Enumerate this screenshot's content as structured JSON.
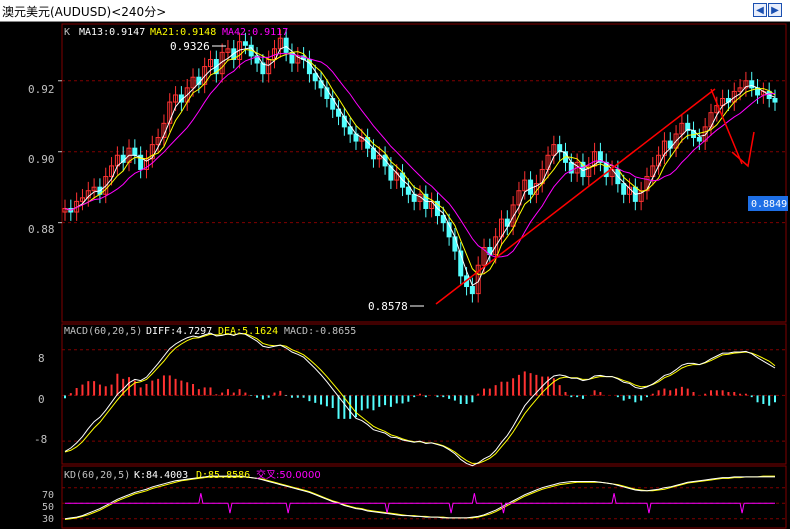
{
  "window": {
    "title": "澳元美元(AUDUSD)<240分>"
  },
  "controls": {
    "prev_icon": "arrow-left-icon",
    "next_icon": "arrow-right-icon",
    "menu_icon": "menu-icon"
  },
  "colors": {
    "up": "#ff3232",
    "down": "#54ffff",
    "ma13": "#ffffff",
    "ma21": "#ffff00",
    "ma42": "#ff00ff",
    "grid": "#800000",
    "axis_text": "#c0c0c0",
    "trend": "#ff0000",
    "price_tag_bg": "#1e6fe6"
  },
  "price_panel": {
    "label": "K",
    "ma13_label": "MA13:0.9147",
    "ma21_label": "MA21:0.9148",
    "ma42_label": "MA42:0.9117",
    "y_ticks": [
      "0.92",
      "0.90",
      "0.88"
    ],
    "high_label": "0.9326",
    "low_label": "0.8578",
    "last_price_tag": "0.8849"
  },
  "macd_panel": {
    "label": "MACD(60,20,5)",
    "diff_label": "DIFF:4.7297",
    "dea_label": "DEA:5.1624",
    "macd_label": "MACD:-0.8655",
    "y_ticks": [
      "8",
      "0",
      "-8"
    ]
  },
  "kd_panel": {
    "label": "KD(60,20,5)",
    "k_label": "K:84.4003",
    "d_label": "D:85.8586",
    "cross_label": "交叉:50.0000",
    "y_ticks": [
      "70",
      "50",
      "30"
    ]
  },
  "chart_data": {
    "type": "candlestick",
    "price_ylim": [
      0.852,
      0.936
    ],
    "macd_ylim": [
      -12,
      12.5
    ],
    "kd_ylim": [
      18,
      98
    ],
    "closes": [
      0.884,
      0.883,
      0.886,
      0.887,
      0.889,
      0.89,
      0.888,
      0.893,
      0.896,
      0.899,
      0.897,
      0.901,
      0.899,
      0.895,
      0.898,
      0.902,
      0.904,
      0.908,
      0.914,
      0.916,
      0.914,
      0.918,
      0.921,
      0.919,
      0.924,
      0.926,
      0.922,
      0.928,
      0.929,
      0.926,
      0.931,
      0.93,
      0.927,
      0.925,
      0.922,
      0.926,
      0.929,
      0.932,
      0.928,
      0.925,
      0.927,
      0.926,
      0.922,
      0.92,
      0.918,
      0.915,
      0.912,
      0.91,
      0.907,
      0.905,
      0.903,
      0.904,
      0.901,
      0.898,
      0.899,
      0.896,
      0.892,
      0.894,
      0.89,
      0.888,
      0.886,
      0.888,
      0.884,
      0.886,
      0.882,
      0.88,
      0.876,
      0.872,
      0.865,
      0.862,
      0.86,
      0.868,
      0.873,
      0.871,
      0.876,
      0.881,
      0.879,
      0.885,
      0.889,
      0.892,
      0.888,
      0.891,
      0.895,
      0.899,
      0.902,
      0.9,
      0.897,
      0.894,
      0.897,
      0.893,
      0.896,
      0.9,
      0.897,
      0.893,
      0.895,
      0.891,
      0.888,
      0.89,
      0.886,
      0.889,
      0.893,
      0.896,
      0.899,
      0.903,
      0.901,
      0.905,
      0.908,
      0.906,
      0.904,
      0.903,
      0.907,
      0.911,
      0.913,
      0.915,
      0.914,
      0.917,
      0.918,
      0.92,
      0.918,
      0.916,
      0.917,
      0.915,
      0.914
    ],
    "macd_diff": [
      -9.8,
      -9.2,
      -8.3,
      -7.2,
      -5.8,
      -4.6,
      -3.8,
      -2.6,
      -1.2,
      0.2,
      1.1,
      2.2,
      2.8,
      2.6,
      3.2,
      4.4,
      5.6,
      6.9,
      8.2,
      9.0,
      9.6,
      10.1,
      10.4,
      10.2,
      10.6,
      10.9,
      10.4,
      10.5,
      10.8,
      10.5,
      10.9,
      10.7,
      10.1,
      9.5,
      8.6,
      8.4,
      8.6,
      8.8,
      8.3,
      7.6,
      7.2,
      6.7,
      5.7,
      4.7,
      3.6,
      2.4,
      1.1,
      -0.2,
      -1.5,
      -2.8,
      -4.0,
      -4.4,
      -5.1,
      -6.0,
      -6.3,
      -6.6,
      -7.3,
      -7.4,
      -7.8,
      -8.0,
      -8.2,
      -8.0,
      -8.4,
      -8.3,
      -8.6,
      -8.9,
      -9.5,
      -10.2,
      -11.2,
      -11.9,
      -12.3,
      -11.8,
      -11.1,
      -10.6,
      -9.6,
      -8.2,
      -7.0,
      -5.4,
      -3.6,
      -1.8,
      -0.6,
      0.5,
      1.6,
      2.6,
      3.4,
      3.6,
      3.4,
      3.0,
      3.0,
      2.6,
      2.8,
      3.4,
      3.5,
      3.3,
      3.3,
      2.9,
      2.3,
      2.1,
      1.4,
      1.2,
      1.5,
      2.0,
      2.7,
      3.5,
      3.8,
      4.5,
      5.3,
      5.6,
      5.6,
      5.4,
      5.8,
      6.4,
      6.9,
      7.4,
      7.4,
      7.6,
      7.6,
      7.7,
      7.3,
      6.6,
      6.0,
      5.4,
      4.8
    ],
    "macd_dea": [
      -9.9,
      -9.6,
      -9.0,
      -8.1,
      -6.9,
      -5.7,
      -4.7,
      -3.4,
      -2.1,
      -0.8,
      0.4,
      1.4,
      2.2,
      2.4,
      2.8,
      3.8,
      4.9,
      6.0,
      7.3,
      8.3,
      9.0,
      9.6,
      10.0,
      10.1,
      10.4,
      10.7,
      10.6,
      10.6,
      10.7,
      10.6,
      10.8,
      10.8,
      10.4,
      9.9,
      9.1,
      8.8,
      8.7,
      8.8,
      8.6,
      8.0,
      7.6,
      7.1,
      6.3,
      5.4,
      4.4,
      3.3,
      2.1,
      0.9,
      -0.4,
      -1.7,
      -3.0,
      -3.8,
      -4.6,
      -5.4,
      -5.9,
      -6.3,
      -6.9,
      -7.2,
      -7.6,
      -7.9,
      -8.1,
      -8.1,
      -8.3,
      -8.3,
      -8.5,
      -8.8,
      -9.3,
      -9.9,
      -10.7,
      -11.4,
      -11.9,
      -11.9,
      -11.5,
      -11.0,
      -10.2,
      -9.0,
      -7.8,
      -6.4,
      -4.8,
      -3.2,
      -1.9,
      -0.7,
      0.5,
      1.5,
      2.4,
      3.0,
      3.2,
      3.1,
      3.1,
      2.8,
      2.8,
      3.1,
      3.3,
      3.3,
      3.3,
      3.0,
      2.6,
      2.3,
      1.8,
      1.5,
      1.6,
      1.9,
      2.4,
      3.1,
      3.5,
      4.1,
      4.8,
      5.2,
      5.4,
      5.4,
      5.7,
      6.1,
      6.6,
      7.1,
      7.2,
      7.4,
      7.5,
      7.6,
      7.4,
      7.0,
      6.5,
      6.0,
      5.2
    ],
    "kd_k": [
      30,
      31,
      32,
      34,
      37,
      40,
      43,
      47,
      51,
      55,
      58,
      61,
      64,
      66,
      68,
      71,
      73,
      75,
      77,
      79,
      80,
      81,
      82,
      83,
      84,
      85,
      85,
      85,
      85,
      85,
      85,
      84,
      83,
      82,
      80,
      78,
      76,
      74,
      72,
      70,
      68,
      66,
      64,
      61,
      58,
      55,
      52,
      50,
      47,
      45,
      43,
      42,
      40,
      39,
      38,
      37,
      36,
      35,
      34,
      34,
      33,
      33,
      32,
      32,
      32,
      31,
      31,
      31,
      31,
      31,
      32,
      33,
      35,
      38,
      41,
      45,
      49,
      53,
      57,
      61,
      64,
      67,
      70,
      72,
      74,
      76,
      77,
      78,
      78,
      78,
      78,
      78,
      77,
      76,
      75,
      73,
      71,
      69,
      67,
      66,
      66,
      67,
      68,
      70,
      71,
      73,
      75,
      77,
      78,
      79,
      80,
      81,
      82,
      83,
      83,
      84,
      84,
      84,
      84,
      84,
      84,
      84,
      84
    ],
    "kd_d": [
      29,
      30,
      31,
      33,
      35,
      38,
      41,
      45,
      49,
      53,
      56,
      59,
      62,
      64,
      66,
      69,
      71,
      73,
      75,
      77,
      79,
      80,
      81,
      82,
      83,
      84,
      84,
      84,
      84,
      84,
      84,
      84,
      83,
      82,
      81,
      79,
      77,
      75,
      73,
      71,
      69,
      67,
      65,
      62,
      59,
      56,
      53,
      51,
      48,
      46,
      44,
      43,
      41,
      40,
      39,
      38,
      37,
      36,
      35,
      34,
      34,
      33,
      33,
      32,
      32,
      32,
      31,
      31,
      31,
      31,
      31,
      32,
      34,
      36,
      39,
      43,
      47,
      51,
      55,
      59,
      62,
      65,
      68,
      70,
      72,
      74,
      75,
      76,
      77,
      77,
      77,
      77,
      77,
      76,
      75,
      74,
      72,
      70,
      68,
      67,
      66,
      66,
      67,
      68,
      70,
      72,
      74,
      76,
      77,
      78,
      79,
      80,
      81,
      82,
      82,
      83,
      83,
      84,
      84,
      84,
      85,
      85,
      85
    ],
    "kd_cross": 50
  }
}
